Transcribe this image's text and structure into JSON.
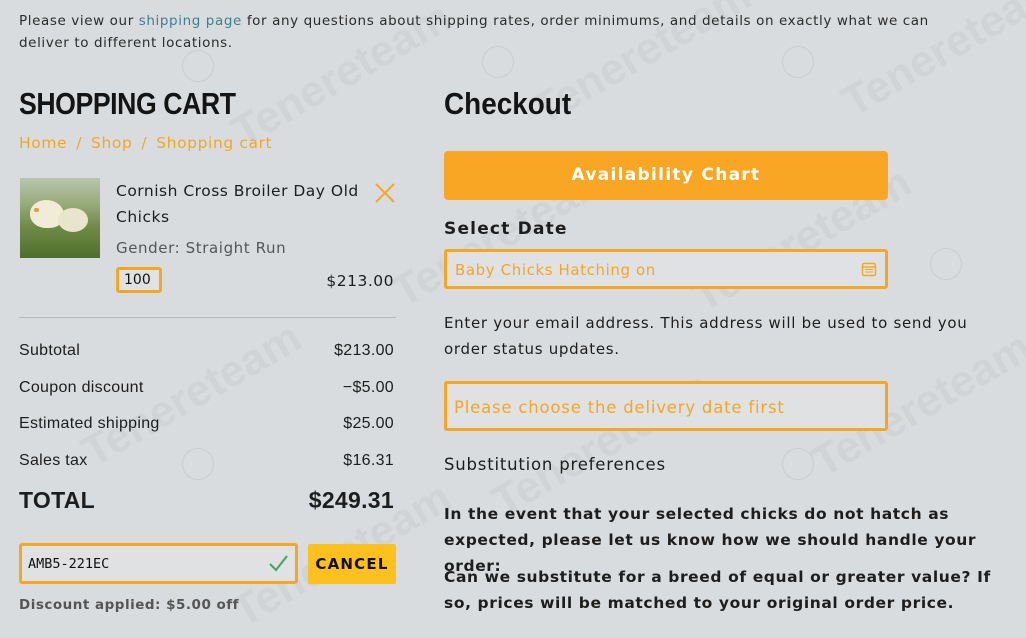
{
  "notice": {
    "before": "Please view our ",
    "link": "shipping page",
    "after": " for any questions about shipping rates, order minimums, and details on exactly what we can deliver to different locations."
  },
  "cart": {
    "title": "SHOPPING CART",
    "breadcrumb": [
      "Home",
      "Shop",
      "Shopping cart"
    ],
    "item": {
      "name": "Cornish Cross Broiler Day Old Chicks",
      "meta": "Gender: Straight Run",
      "quantity": "100",
      "price": "$213.00"
    },
    "summary": [
      {
        "label": "Subtotal",
        "value": "$213.00"
      },
      {
        "label": "Coupon discount",
        "value": "−$5.00"
      },
      {
        "label": "Estimated shipping",
        "value": "$25.00"
      },
      {
        "label": "Sales tax",
        "value": "$16.31"
      }
    ],
    "total": {
      "label": "TOTAL",
      "value": "$249.31"
    },
    "coupon": {
      "code": "AMB5-221EC",
      "cancel_label": "CANCEL",
      "discount_note": "Discount applied: $5.00 off"
    }
  },
  "checkout": {
    "title": "Checkout",
    "availability_label": "Availability Chart",
    "select_date_label": "Select Date",
    "date_placeholder": "Baby Chicks Hatching on",
    "email_note": "Enter your email address. This address will be used to send you order status updates.",
    "delivery_placeholder": "Please choose the delivery date first",
    "substitution_label": "Substitution preferences",
    "substitution_text_1": "In the event that your selected chicks do not hatch as expected, please let us know how we should handle your order:",
    "substitution_text_2": "Can we substitute for a breed of equal or greater value? If so, prices will be matched to your original order price."
  },
  "watermark": "Tenereteam",
  "colors": {
    "accent": "#f5a623",
    "cancel_bg": "#fcc11f",
    "background": "#d9dcde",
    "check": "#3aa856"
  }
}
